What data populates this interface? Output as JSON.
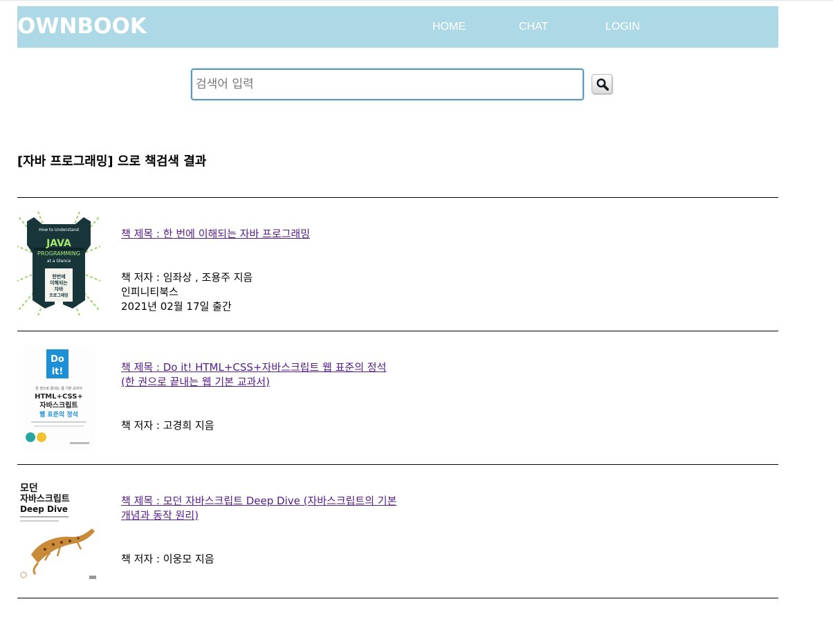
{
  "header": {
    "logo": "OWNBOOK",
    "nav": [
      "HOME",
      "CHAT",
      "LOGIN"
    ]
  },
  "search": {
    "placeholder": "검색어 입력",
    "value": "",
    "button_icon": "magnifier-icon"
  },
  "results": {
    "heading": "[자바 프로그래밍] 으로 책검색 결과",
    "books": [
      {
        "title": "책 제목 : 한 번에 이해되는 자바 프로그래밍",
        "author": "책 저자 : 임좌상 , 조용주 지음",
        "publisher": "인피니티북스",
        "date": "2021년 02월 17일 출간",
        "cover": {
          "top_text": "How to Understand",
          "big_text_1": "JAVA",
          "big_text_2": "PROGRAMMING",
          "sub_text": "at a Glance",
          "kr_title_1": "한번에",
          "kr_title_2": "이해되는",
          "kr_title_3": "자바",
          "kr_title_4": "프로그래밍"
        }
      },
      {
        "title": "책 제목 : Do it! HTML+CSS+자바스크립트 웹 표준의 정석 (한 권으로 끝내는 웹 기본 교과서)",
        "author": "책 저자 : 고경희 지음",
        "cover": {
          "badge_1": "Do",
          "badge_2": "it!",
          "tagline": "한 권으로 끝내는 웹 기본 교과서",
          "line_1": "HTML+CSS+",
          "line_2": "자바스크립트",
          "line_3": "웹 표준의 정석"
        }
      },
      {
        "title": "책 제목 : 모던 자바스크립트 Deep Dive (자바스크립트의 기본 개념과 동작 원리)",
        "author": "책 저자 : 이웅모 지음",
        "cover": {
          "line_1": "모던",
          "line_2": "자바스크립트",
          "line_3": "Deep Dive"
        }
      }
    ]
  }
}
